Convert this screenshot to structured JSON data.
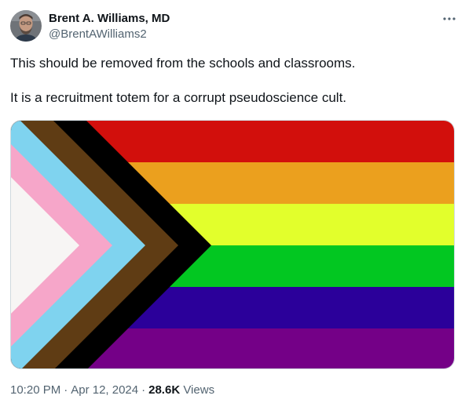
{
  "author": {
    "display_name": "Brent A. Williams, MD",
    "handle": "@BrentAWilliams2"
  },
  "tweet": {
    "paragraphs": [
      "This should be removed from the schools and classrooms.",
      "It is a recruitment totem for a corrupt pseudoscience cult."
    ]
  },
  "media": {
    "stripe_colors": [
      "#d20f0c",
      "#eba01e",
      "#e2ff2c",
      "#02c721",
      "#2b009a",
      "#740087"
    ],
    "chevron_colors": [
      "#000000",
      "#5f3c14",
      "#7fd3ef",
      "#f6a6c9",
      "#f7f5f4"
    ]
  },
  "meta": {
    "time": "10:20 PM",
    "separator": "·",
    "date": "Apr 12, 2024",
    "views_count": "28.6K",
    "views_label": "Views"
  },
  "colors": {
    "text_primary": "#0f1419",
    "text_secondary": "#536471",
    "border": "#cfd9de"
  }
}
